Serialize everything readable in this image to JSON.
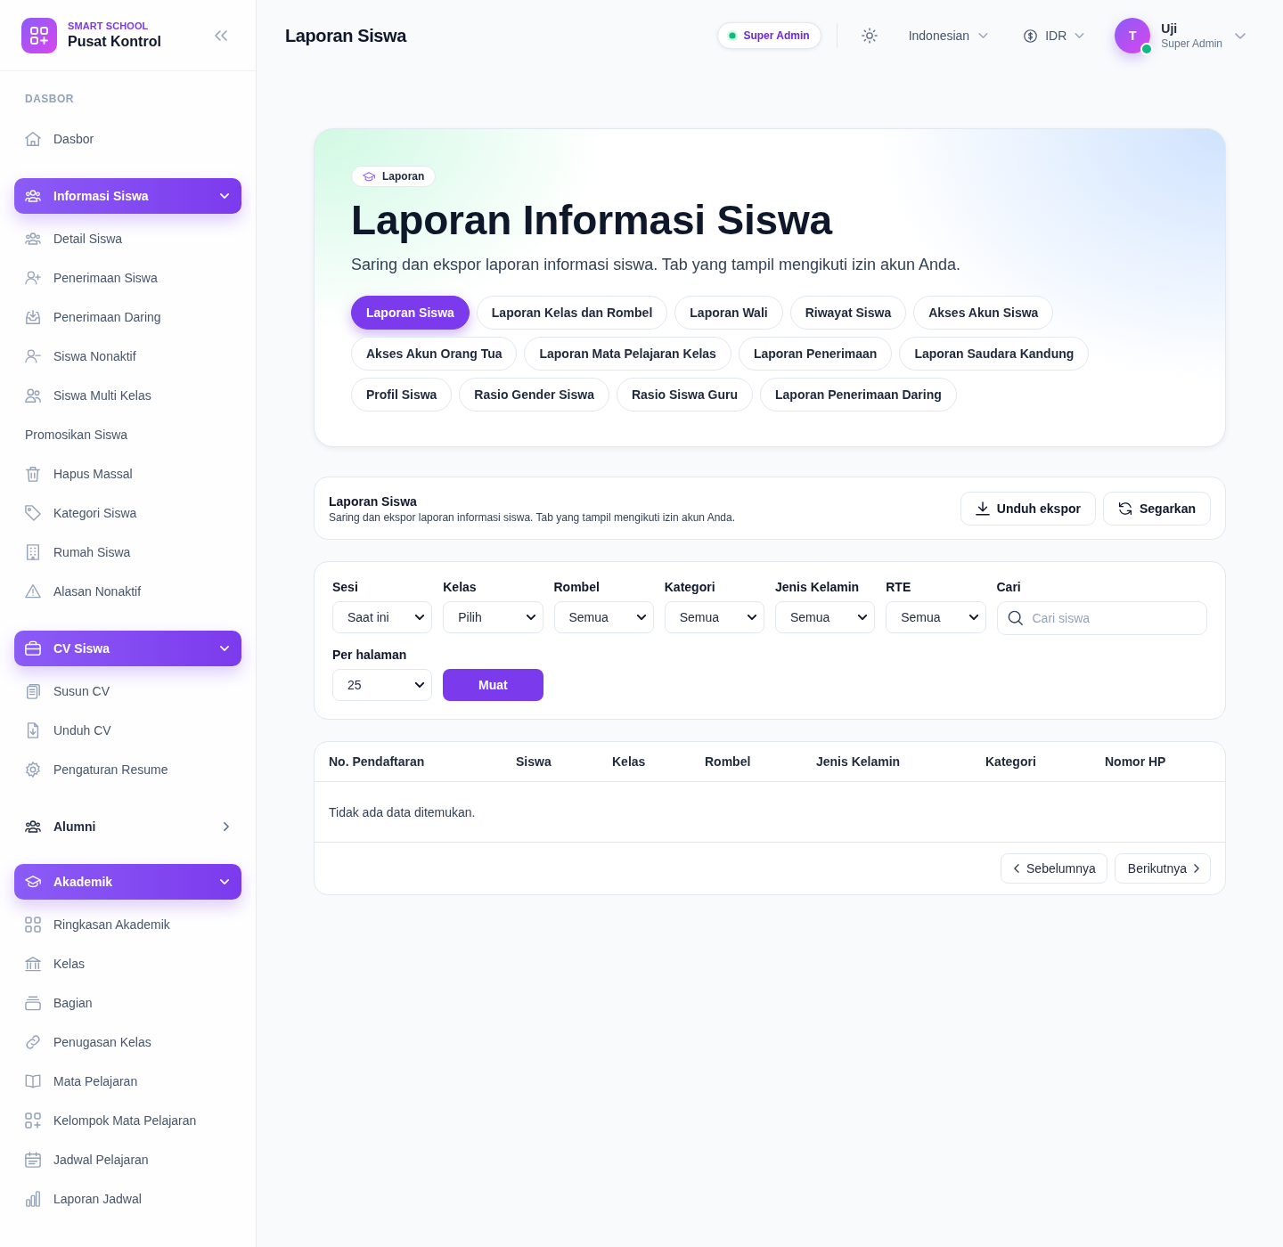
{
  "sidebar": {
    "brand": {
      "eyebrow": "SMART SCHOOL",
      "title": "Pusat Kontrol"
    },
    "section_label": "DASBOR",
    "nav": [
      {
        "kind": "link",
        "label": "Dasbor"
      },
      {
        "kind": "group",
        "label": "Informasi Siswa",
        "expanded": true,
        "children": [
          {
            "label": "Detail Siswa"
          },
          {
            "label": "Penerimaan Siswa"
          },
          {
            "label": "Penerimaan Daring"
          },
          {
            "label": "Siswa Nonaktif"
          },
          {
            "label": "Siswa Multi Kelas"
          },
          {
            "label": "Promosikan Siswa"
          },
          {
            "label": "Hapus Massal"
          },
          {
            "label": "Kategori Siswa"
          },
          {
            "label": "Rumah Siswa"
          },
          {
            "label": "Alasan Nonaktif"
          }
        ]
      },
      {
        "kind": "group",
        "label": "CV Siswa",
        "expanded": true,
        "children": [
          {
            "label": "Susun CV"
          },
          {
            "label": "Unduh CV"
          },
          {
            "label": "Pengaturan Resume"
          }
        ]
      },
      {
        "kind": "group",
        "label": "Alumni",
        "expanded": false
      },
      {
        "kind": "group",
        "label": "Akademik",
        "expanded": true,
        "children": [
          {
            "label": "Ringkasan Akademik"
          },
          {
            "label": "Kelas"
          },
          {
            "label": "Bagian"
          },
          {
            "label": "Penugasan Kelas"
          },
          {
            "label": "Mata Pelajaran"
          },
          {
            "label": "Kelompok Mata Pelajaran"
          },
          {
            "label": "Jadwal Pelajaran"
          },
          {
            "label": "Laporan Jadwal"
          }
        ]
      }
    ]
  },
  "header": {
    "title": "Laporan Siswa",
    "role_badge": "Super Admin",
    "language": "Indonesian",
    "currency": "IDR",
    "user": {
      "initial": "T",
      "name": "Uji",
      "role": "Super Admin",
      "online": true
    }
  },
  "hero": {
    "badge": "Laporan",
    "title": "Laporan Informasi Siswa",
    "subtitle": "Saring dan ekspor laporan informasi siswa. Tab yang tampil mengikuti izin akun Anda.",
    "tabs": [
      {
        "label": "Laporan Siswa",
        "selected": true
      },
      {
        "label": "Laporan Kelas dan Rombel",
        "selected": false
      },
      {
        "label": "Laporan Wali",
        "selected": false
      },
      {
        "label": "Riwayat Siswa",
        "selected": false
      },
      {
        "label": "Akses Akun Siswa",
        "selected": false
      },
      {
        "label": "Akses Akun Orang Tua",
        "selected": false
      },
      {
        "label": "Laporan Mata Pelajaran Kelas",
        "selected": false
      },
      {
        "label": "Laporan Penerimaan",
        "selected": false
      },
      {
        "label": "Laporan Saudara Kandung",
        "selected": false
      },
      {
        "label": "Profil Siswa",
        "selected": false
      },
      {
        "label": "Rasio Gender Siswa",
        "selected": false
      },
      {
        "label": "Rasio Siswa Guru",
        "selected": false
      },
      {
        "label": "Laporan Penerimaan Daring",
        "selected": false
      }
    ]
  },
  "report": {
    "title": "Laporan Siswa",
    "description": "Saring dan ekspor laporan informasi siswa. Tab yang tampil mengikuti izin akun Anda.",
    "actions": [
      {
        "kind": "export",
        "label": "Unduh ekspor"
      },
      {
        "kind": "refresh",
        "label": "Segarkan"
      }
    ]
  },
  "filters": {
    "fields": [
      {
        "kind": "select",
        "label": "Sesi",
        "value": "Saat ini"
      },
      {
        "kind": "select",
        "label": "Kelas",
        "value": "Pilih"
      },
      {
        "kind": "select",
        "label": "Rombel",
        "value": "Semua"
      },
      {
        "kind": "select",
        "label": "Kategori",
        "value": "Semua"
      },
      {
        "kind": "select",
        "label": "Jenis Kelamin",
        "value": "Semua"
      },
      {
        "kind": "select",
        "label": "RTE",
        "value": "Semua"
      },
      {
        "kind": "search",
        "label": "Cari",
        "placeholder": "Cari siswa"
      },
      {
        "kind": "select",
        "label": "Per halaman",
        "value": "25"
      }
    ],
    "submit": "Muat"
  },
  "table": {
    "columns": [
      "No. Pendaftaran",
      "Siswa",
      "Kelas",
      "Rombel",
      "Jenis Kelamin",
      "Kategori",
      "Nomor HP"
    ],
    "empty_message": "Tidak ada data ditemukan.",
    "pagination": {
      "previous": "Sebelumnya",
      "next": "Berikutnya"
    }
  }
}
